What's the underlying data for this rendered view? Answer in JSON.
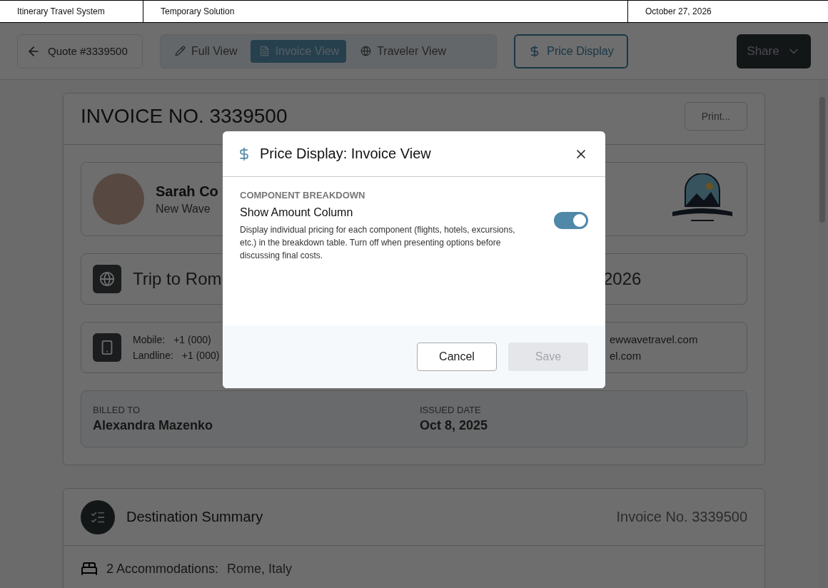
{
  "top_bar": {
    "app_name": "Itinerary Travel System",
    "solution": "Temporary Solution",
    "date": "October 27, 2026"
  },
  "toolbar": {
    "back": {
      "label": "Quote #3339500"
    },
    "views": [
      {
        "label": "Full View",
        "selected": false
      },
      {
        "label": "Invoice View",
        "selected": true
      },
      {
        "label": "Traveler View",
        "selected": false
      }
    ],
    "price_display": {
      "label": "Price Display"
    },
    "share": {
      "label": "Share"
    }
  },
  "invoice": {
    "title": "INVOICE NO. 3339500",
    "print": "Print...",
    "agent": {
      "name": "Sarah Co",
      "company": "New Wave"
    },
    "trip": {
      "title": "Trip to Rom",
      "date_fragment": "2026"
    },
    "contacts": {
      "mobile_label": "Mobile:",
      "mobile_value": "+1 (000)",
      "landline_label": "Landline:",
      "landline_value": "+1 (000)",
      "email_fragments": [
        "ewwavetravel.com",
        "el.com"
      ]
    },
    "billed_to": {
      "label": "BILLED TO",
      "value": "Alexandra Mazenko"
    },
    "issued_date": {
      "label": "ISSUED DATE",
      "value": "Oct 8, 2025"
    }
  },
  "destination_summary": {
    "title": "Destination Summary",
    "invoice_no": "Invoice No. 3339500",
    "accommodations": {
      "label": "2 Accommodations:",
      "value": "Rome, Italy"
    }
  },
  "modal": {
    "title": "Price Display: Invoice View",
    "section": "COMPONENT BREAKDOWN",
    "setting": {
      "title": "Show Amount Column",
      "description": "Display individual pricing for each component (flights, hotels, excursions, etc.) in the breakdown table. Turn off when presenting options before discussing final costs.",
      "on": true
    },
    "cancel": {
      "label": "Cancel"
    },
    "save": {
      "label": "Save",
      "disabled": true
    }
  }
}
